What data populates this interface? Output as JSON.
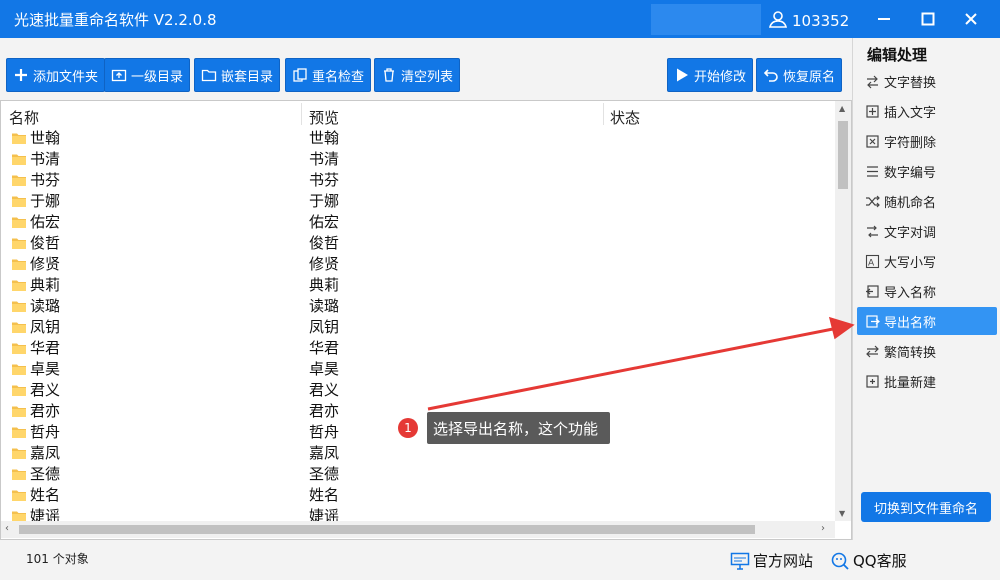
{
  "window": {
    "title": "光速批量重命名软件 V2.2.0.8",
    "user_id": "103352"
  },
  "toolbar": {
    "add_files": "添加文件夹",
    "first_level": "一级目录",
    "nested": "嵌套目录",
    "check_names": "重名检查",
    "clear_list": "清空列表",
    "start": "开始修改",
    "restore": "恢复原名"
  },
  "list": {
    "columns": [
      "名称",
      "预览",
      "状态"
    ],
    "rows": [
      {
        "name": "世翰",
        "preview": "世翰"
      },
      {
        "name": "书清",
        "preview": "书清"
      },
      {
        "name": "书芬",
        "preview": "书芬"
      },
      {
        "name": "于娜",
        "preview": "于娜"
      },
      {
        "name": "佑宏",
        "preview": "佑宏"
      },
      {
        "name": "俊哲",
        "preview": "俊哲"
      },
      {
        "name": "修贤",
        "preview": "修贤"
      },
      {
        "name": "典莉",
        "preview": "典莉"
      },
      {
        "name": "读璐",
        "preview": "读璐"
      },
      {
        "name": "凤钥",
        "preview": "凤钥"
      },
      {
        "name": "华君",
        "preview": "华君"
      },
      {
        "name": "卓昊",
        "preview": "卓昊"
      },
      {
        "name": "君义",
        "preview": "君义"
      },
      {
        "name": "君亦",
        "preview": "君亦"
      },
      {
        "name": "哲舟",
        "preview": "哲舟"
      },
      {
        "name": "嘉凤",
        "preview": "嘉凤"
      },
      {
        "name": "圣德",
        "preview": "圣德"
      },
      {
        "name": "姓名",
        "preview": "姓名"
      },
      {
        "name": "婕谣",
        "preview": "婕谣"
      }
    ]
  },
  "right_panel": {
    "title": "编辑处理",
    "items": [
      {
        "label": "文字替换",
        "icon": "replace-icon"
      },
      {
        "label": "插入文字",
        "icon": "insert-icon"
      },
      {
        "label": "字符删除",
        "icon": "delete-char-icon"
      },
      {
        "label": "数字编号",
        "icon": "numbering-icon"
      },
      {
        "label": "随机命名",
        "icon": "shuffle-icon"
      },
      {
        "label": "文字对调",
        "icon": "swap-icon"
      },
      {
        "label": "大写小写",
        "icon": "case-icon"
      },
      {
        "label": "导入名称",
        "icon": "import-icon"
      },
      {
        "label": "导出名称",
        "icon": "export-icon"
      },
      {
        "label": "繁简转换",
        "icon": "convert-icon"
      },
      {
        "label": "批量新建",
        "icon": "new-batch-icon"
      }
    ],
    "active_index": 8,
    "switch_button": "切换到文件重命名"
  },
  "status": {
    "count_text": "101 个对象",
    "website": "官方网站",
    "qq": "QQ客服"
  },
  "annotation": {
    "step": "1",
    "text": "选择导出名称，这个功能"
  },
  "colors": {
    "accent": "#1277e6",
    "active_item": "#3394f3",
    "arrow": "#e53935"
  }
}
